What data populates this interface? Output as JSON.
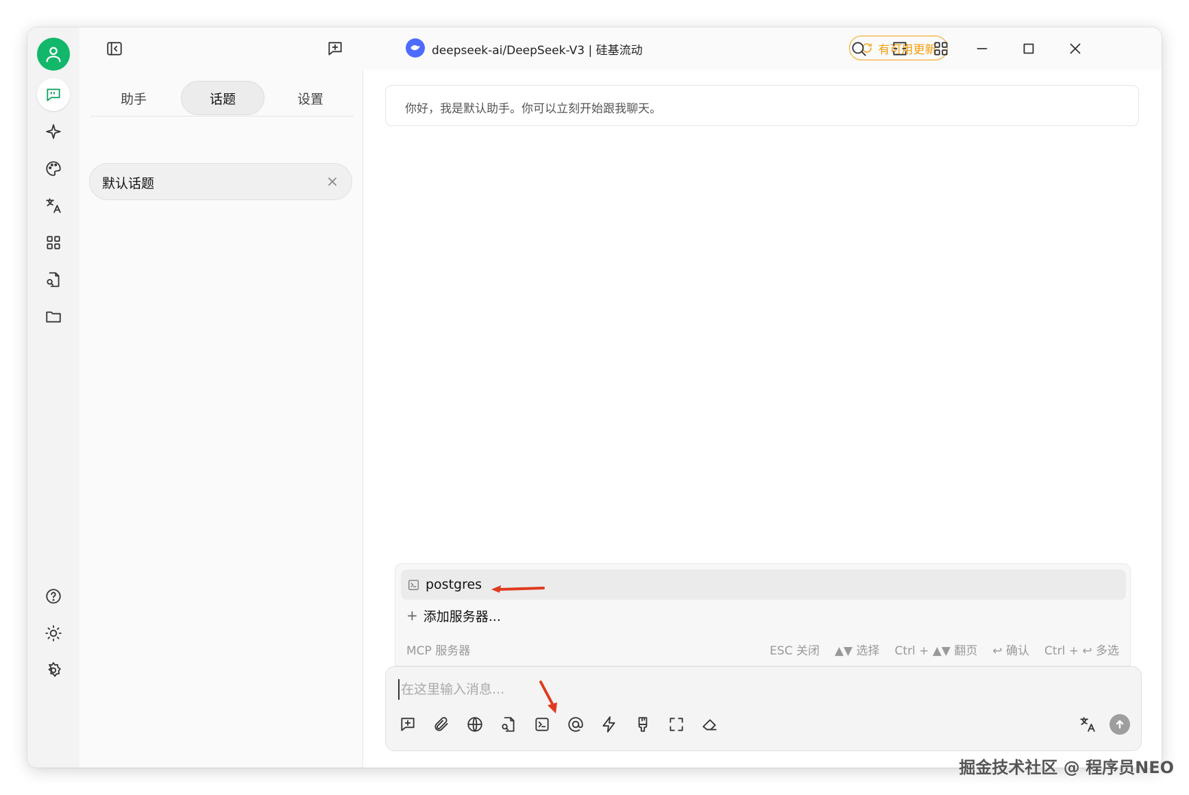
{
  "colors": {
    "accent": "#12b76a",
    "update": "#f59e0b",
    "annotation_arrow": "#e03a1e",
    "model_logo": "#4d6bfe"
  },
  "rail": {
    "top_icons": [
      "avatar-icon",
      "chat-icon",
      "sparkle-icon",
      "palette-icon",
      "translate-icon",
      "apps-icon",
      "doc-search-icon",
      "folder-icon"
    ],
    "bottom_icons": [
      "help-icon",
      "sun-icon",
      "gear-icon"
    ]
  },
  "titlebar": {
    "model_title": "deepseek-ai/DeepSeek-V3 | 硅基流动",
    "update_label": "有可用更新"
  },
  "panel": {
    "tabs": [
      "助手",
      "话题",
      "设置"
    ],
    "active_tab": "话题",
    "topic_label": "默认话题"
  },
  "chat": {
    "greeting": "你好，我是默认助手。你可以立刻开始跟我聊天。",
    "mcp": {
      "server_name": "postgres",
      "add_label": "添加服务器...",
      "footer_title": "MCP 服务器",
      "hints": [
        "ESC 关闭",
        "▲▼ 选择",
        "Ctrl + ▲▼ 翻页",
        "↩ 确认",
        "Ctrl + ↩ 多选"
      ]
    },
    "input_placeholder": "在这里输入消息..."
  },
  "watermark": "掘金技术社区 @ 程序员NEO"
}
